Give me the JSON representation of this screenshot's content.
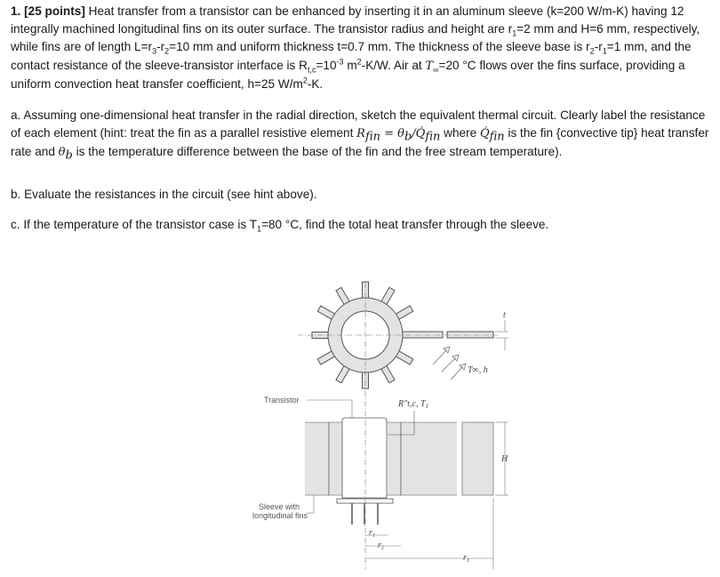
{
  "problem": {
    "number": "1.",
    "points": "[25 points]",
    "statement": {
      "s1": " Heat transfer from a transistor can be enhanced by inserting it in an aluminum sleeve (k=200 W/m-K) having 12 integrally machined longitudinal fins on its outer surface.  The transistor radius and height are r",
      "s1_sub": "1",
      "s2": "=2 mm and H=6 mm, respectively, while fins are of length L=r",
      "s2_sub_a": "3",
      "s2_mid": "-r",
      "s2_sub_b": "2",
      "s3": "=10 mm and uniform thickness t=0.7 mm.  The thickness of the sleeve base is r",
      "s3_sub_a": "2",
      "s3_mid": "-r",
      "s3_sub_b": "1",
      "s4": "=1 mm, and the contact resistance of the sleeve-transistor interface is R",
      "s4_sub": "t,c",
      "s5": "=10",
      "s5_sup": "-3",
      "s6": " m",
      "s6_sup": "2",
      "s7": "-K/W. Air at ",
      "tinf": "T",
      "tinf_sub": "∞",
      "s8": "=20 °C flows over the fins surface, providing a uniform convection heat transfer coefficient, h=25 W/m",
      "s8_sup": "2",
      "s9": "-K."
    },
    "part_a": {
      "t1": "a. Assuming one-dimensional heat transfer in the radial direction, sketch the equivalent thermal circuit.  Clearly label the resistance of each element (hint: treat the fin as a parallel resistive element ",
      "formula": "R",
      "formula_sub": "fin",
      "formula_eq": " = θ",
      "formula_sub_b": "b",
      "formula_div": "/Q̇",
      "formula_sub_c": "fin",
      "t2": " where ",
      "qdot": "Q̇",
      "qdot_sub": "fin",
      "t3": " is the fin {convective tip} heat transfer rate and ",
      "theta": "θ",
      "theta_sub": "b",
      "t4": " is the temperature difference between the base of the fin and the free stream temperature)."
    },
    "part_b": "b. Evaluate the resistances in the circuit (see hint above).",
    "part_c": {
      "t1": "c. If the temperature of the transistor case is T",
      "sub": "1",
      "t2": "=80 °C, find the total heat transfer through the sleeve."
    }
  },
  "figure": {
    "fin_count": 12,
    "labels": {
      "transistor": "Transistor",
      "sleeve_line1": "Sleeve with",
      "sleeve_line2": "longitudinal fins",
      "contact": "R″t,c, T",
      "contact_sub": "1",
      "air": "T∞, h",
      "thickness": "t",
      "height": "H",
      "r1": "r",
      "r1_sub": "1",
      "r2": "r",
      "r2_sub": "2",
      "r3": "r",
      "r3_sub": "3"
    },
    "colors": {
      "fill": "#e3e3e3",
      "stroke": "#555555",
      "text": "#1a1a1a"
    }
  }
}
